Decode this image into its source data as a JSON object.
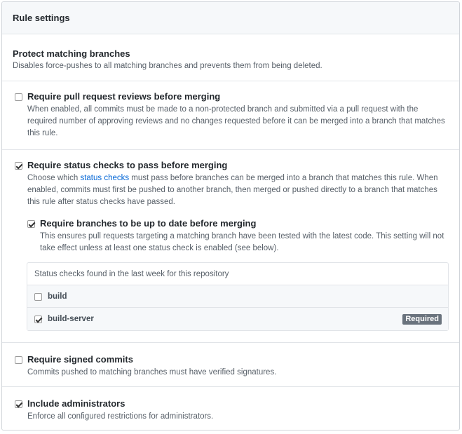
{
  "header": {
    "title": "Rule settings"
  },
  "protect": {
    "title": "Protect matching branches",
    "desc": "Disables force-pushes to all matching branches and prevents them from being deleted."
  },
  "reviews": {
    "checked": false,
    "title": "Require pull request reviews before merging",
    "desc": "When enabled, all commits must be made to a non-protected branch and submitted via a pull request with the required number of approving reviews and no changes requested before it can be merged into a branch that matches this rule."
  },
  "status_checks": {
    "checked": true,
    "title": "Require status checks to pass before merging",
    "desc_pre": "Choose which ",
    "desc_link": "status checks",
    "desc_post": " must pass before branches can be merged into a branch that matches this rule. When enabled, commits must first be pushed to another branch, then merged or pushed directly to a branch that matches this rule after status checks have passed.",
    "up_to_date": {
      "checked": true,
      "title": "Require branches to be up to date before merging",
      "desc": "This ensures pull requests targeting a matching branch have been tested with the latest code. This setting will not take effect unless at least one status check is enabled (see below)."
    },
    "list_header": "Status checks found in the last week for this repository",
    "checks": [
      {
        "name": "build",
        "checked": false,
        "badge": ""
      },
      {
        "name": "build-server",
        "checked": true,
        "badge": "Required"
      }
    ]
  },
  "signed": {
    "checked": false,
    "title": "Require signed commits",
    "desc": "Commits pushed to matching branches must have verified signatures."
  },
  "admins": {
    "checked": true,
    "title": "Include administrators",
    "desc": "Enforce all configured restrictions for administrators."
  }
}
